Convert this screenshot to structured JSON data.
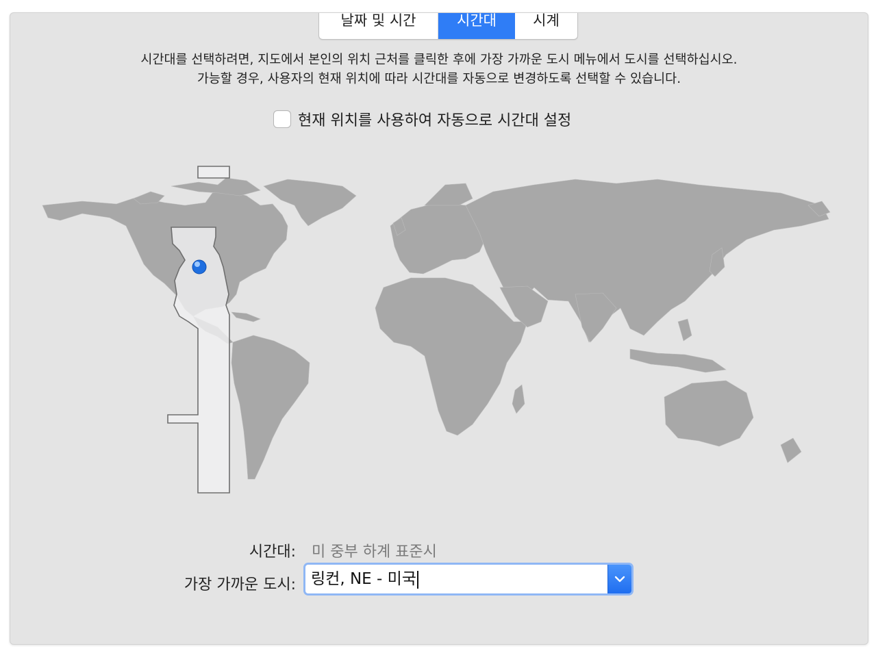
{
  "tabs": [
    {
      "label": "날짜 및 시간",
      "selected": false
    },
    {
      "label": "시간대",
      "selected": true
    },
    {
      "label": "시계",
      "selected": false
    }
  ],
  "description": {
    "line1": "시간대를 선택하려면, 지도에서 본인의 위치 근처를 클릭한 후에 가장 가까운 도시 메뉴에서 도시를 선택하십시오.",
    "line2": "가능할 경우, 사용자의 현재 위치에 따라 시간대를 자동으로 변경하도록 선택할 수 있습니다."
  },
  "auto_timezone": {
    "label": "현재 위치를 사용하여 자동으로 시간대 설정",
    "checked": false
  },
  "timezone": {
    "label": "시간대:",
    "value": "미 중부 하계 표준시"
  },
  "closest_city": {
    "label": "가장 가까운 도시:",
    "value": "링컨, NE - 미국"
  },
  "colors": {
    "accent": "#2f7df6",
    "land": "#a8a8a8",
    "highlight_band": "#ececed",
    "background": "#e4e4e4"
  },
  "icons": {
    "location_pin": "blue-dot-icon",
    "dropdown": "chevron-down-icon"
  }
}
